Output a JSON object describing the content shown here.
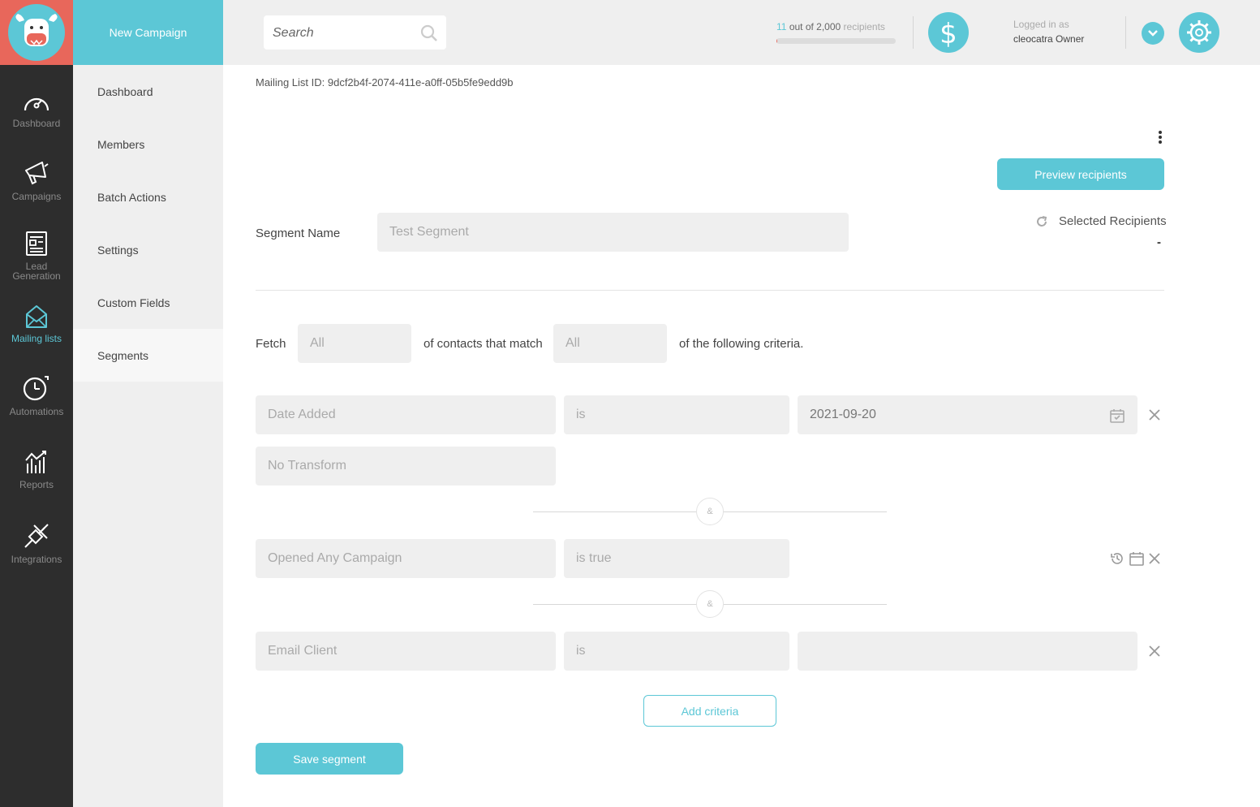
{
  "nav": {
    "items": [
      {
        "label": "Dashboard",
        "icon": "speedometer-icon"
      },
      {
        "label": "Campaigns",
        "icon": "megaphone-icon"
      },
      {
        "label": "Lead Generation",
        "icon": "form-icon"
      },
      {
        "label": "Mailing lists",
        "icon": "envelope-icon",
        "active": true
      },
      {
        "label": "Automations",
        "icon": "stopwatch-icon"
      },
      {
        "label": "Reports",
        "icon": "bar-chart-icon"
      },
      {
        "label": "Integrations",
        "icon": "plug-icon"
      }
    ]
  },
  "subnav": {
    "new_campaign": "New Campaign",
    "items": [
      "Dashboard",
      "Members",
      "Batch Actions",
      "Settings",
      "Custom Fields",
      "Segments"
    ],
    "active": "Segments"
  },
  "header": {
    "search_placeholder": "Search",
    "recipients_count": "11",
    "recipients_of": "out of 2,000",
    "recipients_label": "recipients",
    "recipients_fraction": 0.0055,
    "logged_in_label": "Logged in as",
    "user": "cleocatra Owner"
  },
  "main": {
    "mailing_list_id": "Mailing List ID: 9dcf2b4f-2074-411e-a0ff-05b5fe9edd9b",
    "preview_button": "Preview recipients",
    "segment_name_label": "Segment Name",
    "segment_name_value": "Test Segment",
    "selected_recipients_label": "Selected Recipients",
    "selected_recipients_value": "-",
    "fetch_label": "Fetch",
    "fetch_value": "All",
    "contacts_match_label": "of contacts that match",
    "match_value": "All",
    "criteria_suffix": "of the following criteria.",
    "and_symbol": "&",
    "criteria": [
      {
        "field": "Date Added",
        "operator": "is",
        "value": "2021-09-20",
        "transform": "No Transform"
      },
      {
        "field": "Opened Any Campaign",
        "operator": "is true"
      },
      {
        "field": "Email Client",
        "operator": "is",
        "value": ""
      }
    ],
    "add_criteria_button": "Add criteria",
    "save_button": "Save segment"
  },
  "colors": {
    "accent": "#5cc7d6",
    "logo_bg": "#e8675b",
    "rail": "#2d2d2d"
  }
}
